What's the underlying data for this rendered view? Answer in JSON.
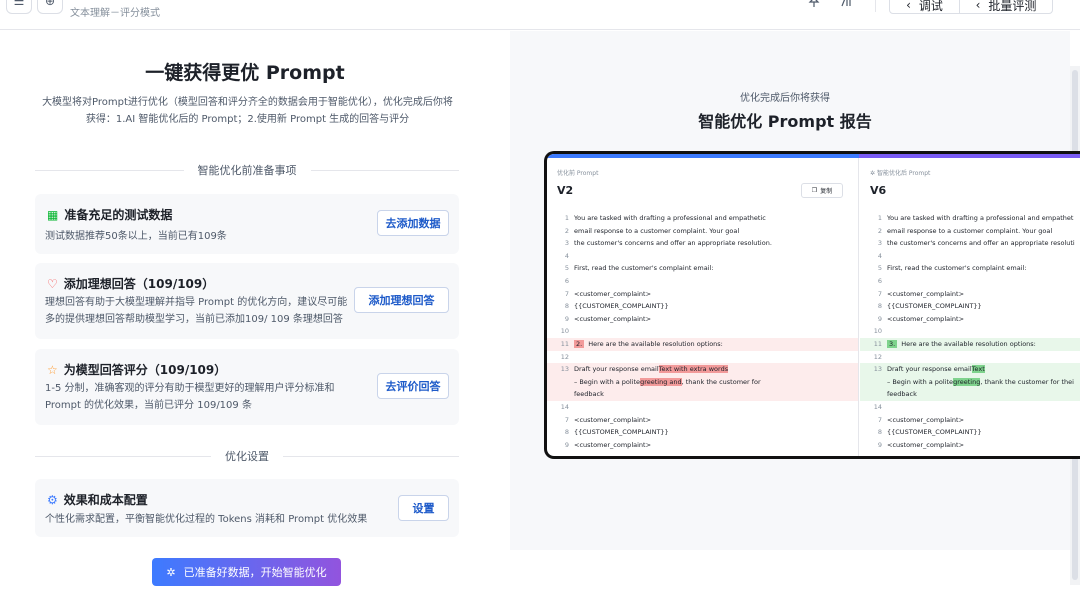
{
  "header": {
    "menu_icon": "menu-icon",
    "subtitle": "文本理解－评分模式",
    "actions": [
      {
        "label": "调试",
        "icon": "chevron-left-icon"
      },
      {
        "label": "批量评测",
        "icon": "chevron-left-icon"
      }
    ]
  },
  "left": {
    "title": "一键获得更优 Prompt",
    "intro": "大模型将对Prompt进行优化（模型回答和评分齐全的数据会用于智能优化），优化完成后你将获得：1.AI 智能优化后的 Prompt；2.使用新 Prompt 生成的回答与评分",
    "prep_section": "智能优化前准备事项",
    "cards": [
      {
        "icon": "table-icon",
        "title": "准备充足的测试数据",
        "desc": "测试数据推荐50条以上，当前已有109条",
        "button": "去添加数据"
      },
      {
        "icon": "heart-icon",
        "title": "添加理想回答（109/109）",
        "desc": "理想回答有助于大模型理解并指导 Prompt 的优化方向，建议尽可能多的提供理想回答帮助模型学习，当前已添加109/ 109 条理想回答",
        "button": "添加理想回答"
      },
      {
        "icon": "star-icon",
        "title": "为模型回答评分（109/109）",
        "desc": "1-5 分制，准确客观的评分有助于模型更好的理解用户评分标准和 Prompt 的优化效果，当前已评分 109/109 条",
        "button": "去评价回答"
      }
    ],
    "settings_section": "优化设置",
    "settings_card": {
      "icon": "gear-icon",
      "title": "效果和成本配置",
      "desc": "个性化需求配置，平衡智能优化过程的 Tokens 消耗和 Prompt 优化效果",
      "button": "设置"
    },
    "cta": "已准备好数据，开始智能优化"
  },
  "right": {
    "small": "优化完成后你将获得",
    "title": "智能优化 Prompt 报告",
    "colors": {
      "accent_blue": "#3d7bff",
      "accent_purple": "#7a5cf5",
      "removed": "#f29a9a",
      "added": "#7fd38d"
    },
    "before": {
      "label": "优化前 Prompt",
      "version": "V2",
      "copy": "复制",
      "lines": [
        {
          "n": "1",
          "t": "You are tasked with drafting a professional and empathetic"
        },
        {
          "n": "2",
          "t": "email response to a customer complaint. Your goal"
        },
        {
          "n": "3",
          "t": "the customer's concerns and offer an appropriate resolution."
        },
        {
          "n": "4",
          "t": ""
        },
        {
          "n": "5",
          "t": "First, read the customer's complaint email:"
        },
        {
          "n": "6",
          "t": ""
        },
        {
          "n": "7",
          "t": "<customer_complaint>"
        },
        {
          "n": "8",
          "t": "{{CUSTOMER_COMPLAINT}}"
        },
        {
          "n": "9",
          "t": "<customer_complaint>"
        },
        {
          "n": "10",
          "t": ""
        },
        {
          "n": "11",
          "t": "Here are the available resolution options:",
          "num": "2."
        },
        {
          "n": "12",
          "t": ""
        },
        {
          "n": "13",
          "t1": "Draft your response email",
          "hl1": "Text with extra words"
        },
        {
          "n": "",
          "t1": "– Begin with a polite",
          "hl2": "greeting and",
          "t2": ", thank the customer for"
        },
        {
          "n": "",
          "t": "feedback"
        },
        {
          "n": "14",
          "t": ""
        },
        {
          "n": "7",
          "t": "<customer_complaint>"
        },
        {
          "n": "8",
          "t": "{{CUSTOMER_COMPLAINT}}"
        },
        {
          "n": "9",
          "t": "<customer_complaint>"
        }
      ]
    },
    "after": {
      "label": "智能优化后 Prompt",
      "version": "V6",
      "lines": [
        {
          "n": "1",
          "t": "You are tasked with drafting a professional and empathet"
        },
        {
          "n": "2",
          "t": "email response to a customer complaint. Your goal"
        },
        {
          "n": "3",
          "t": "the customer's concerns and offer an appropriate resoluti"
        },
        {
          "n": "4",
          "t": ""
        },
        {
          "n": "5",
          "t": "First, read the customer's complaint email:"
        },
        {
          "n": "6",
          "t": ""
        },
        {
          "n": "7",
          "t": "<customer_complaint>"
        },
        {
          "n": "8",
          "t": "{{CUSTOMER_COMPLAINT}}"
        },
        {
          "n": "9",
          "t": "<customer_complaint>"
        },
        {
          "n": "10",
          "t": ""
        },
        {
          "n": "11",
          "t": "Here are the available resolution options:",
          "num": "3."
        },
        {
          "n": "12",
          "t": ""
        },
        {
          "n": "13",
          "t1": "Draft your response email",
          "hl1": "Text"
        },
        {
          "n": "",
          "t1": "– Begin with a polite",
          "hl2": "greeting",
          "t2": ", thank the customer for thei"
        },
        {
          "n": "",
          "t": "feedback"
        },
        {
          "n": "14",
          "t": ""
        },
        {
          "n": "7",
          "t": "<customer_complaint>"
        },
        {
          "n": "8",
          "t": "{{CUSTOMER_COMPLAINT}}"
        },
        {
          "n": "9",
          "t": "<customer_complaint>"
        }
      ]
    }
  }
}
